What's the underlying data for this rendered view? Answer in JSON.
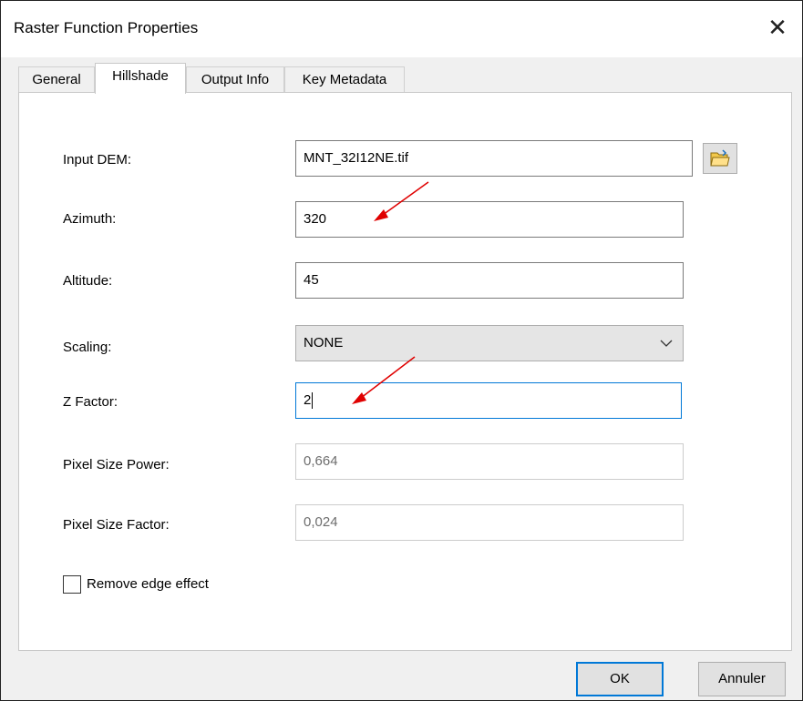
{
  "window": {
    "title": "Raster Function Properties"
  },
  "tabs": [
    {
      "label": "General"
    },
    {
      "label": "Hillshade"
    },
    {
      "label": "Output Info"
    },
    {
      "label": "Key Metadata"
    }
  ],
  "form": {
    "input_dem": {
      "label": "Input DEM:",
      "value": "MNT_32I12NE.tif"
    },
    "azimuth": {
      "label": "Azimuth:",
      "value": "320"
    },
    "altitude": {
      "label": "Altitude:",
      "value": "45"
    },
    "scaling": {
      "label": "Scaling:",
      "value": "NONE"
    },
    "z_factor": {
      "label": "Z Factor:",
      "value": "2"
    },
    "pixel_size_power": {
      "label": "Pixel Size Power:",
      "value": "0,664"
    },
    "pixel_size_factor": {
      "label": "Pixel Size Factor:",
      "value": "0,024"
    },
    "remove_edge_effect": {
      "label": "Remove edge effect",
      "checked": false
    }
  },
  "buttons": {
    "ok": "OK",
    "cancel": "Annuler"
  },
  "colors": {
    "focus_border": "#0078d7",
    "annotation_arrow": "#e00000",
    "folder_icon": "#e8b830"
  },
  "icons": {
    "close": "close-icon",
    "browse": "folder-open-icon",
    "dropdown": "chevron-down-icon"
  }
}
